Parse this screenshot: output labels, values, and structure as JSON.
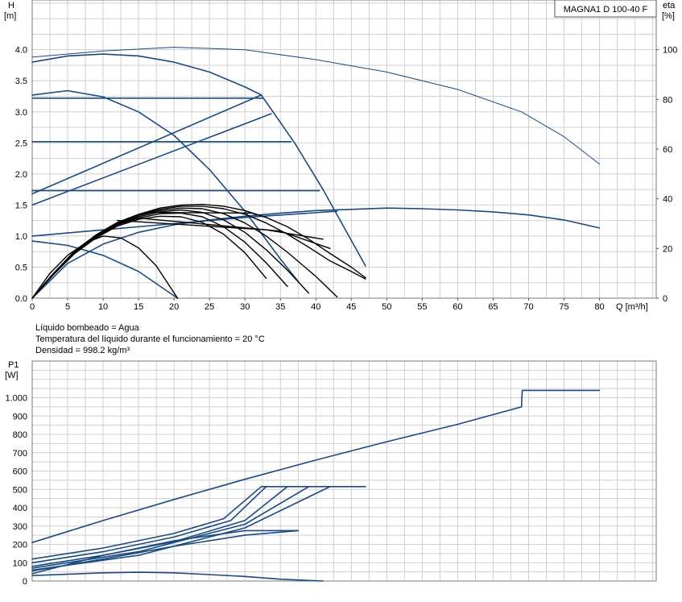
{
  "model_label": "MAGNA1 D 100-40 F",
  "info_lines": [
    "Líquido bombeado = Agua",
    "Temperatura del líquido durante el funcionamiento = 20 °C",
    "Densidad = 998.2 kg/m³"
  ],
  "chart_data": [
    {
      "type": "line",
      "title": "",
      "x_label": "Q [m³/h]",
      "y_label_line1": "H",
      "y_label_line2": "[m]",
      "y2_label_line1": "eta",
      "y2_label_line2": "[%]",
      "xlim": [
        0,
        88
      ],
      "ylim": [
        0,
        4.8
      ],
      "y2lim": [
        0,
        120
      ],
      "x_ticks": [
        "0",
        "5",
        "10",
        "15",
        "20",
        "25",
        "30",
        "35",
        "40",
        "45",
        "50",
        "55",
        "60",
        "65",
        "70",
        "75",
        "80"
      ],
      "y_ticks": [
        "0.0",
        "0.5",
        "1.0",
        "1.5",
        "2.0",
        "2.5",
        "3.0",
        "3.5",
        "4.0"
      ],
      "y2_ticks": [
        "0",
        "20",
        "40",
        "60",
        "80",
        "100"
      ],
      "grid": true,
      "series": [
        {
          "group": "head",
          "color": "#1a4a80",
          "points": [
            [
              0,
              3.8
            ],
            [
              5,
              3.9
            ],
            [
              10,
              3.93
            ],
            [
              15,
              3.9
            ],
            [
              20,
              3.8
            ],
            [
              25,
              3.64
            ],
            [
              30,
              3.4
            ],
            [
              32.3,
              3.27
            ]
          ]
        },
        {
          "group": "head",
          "color": "#1a4a80",
          "points": [
            [
              32.3,
              3.27
            ],
            [
              37,
              2.5
            ],
            [
              41,
              1.75
            ],
            [
              47,
              0.52
            ]
          ]
        },
        {
          "group": "head",
          "color": "#1a4a80",
          "points": [
            [
              0,
              3.27
            ],
            [
              5,
              3.34
            ],
            [
              10,
              3.24
            ],
            [
              15,
              3.0
            ],
            [
              20,
              2.62
            ],
            [
              25,
              2.07
            ],
            [
              30,
              1.4
            ],
            [
              35,
              0.63
            ],
            [
              37.5,
              0.27
            ]
          ]
        },
        {
          "group": "head",
          "color": "#1a4a80",
          "points": [
            [
              0,
              3.22
            ],
            [
              32.5,
              3.22
            ]
          ]
        },
        {
          "group": "head",
          "color": "#1a4a80",
          "points": [
            [
              0,
              2.52
            ],
            [
              36.5,
              2.52
            ]
          ]
        },
        {
          "group": "head",
          "color": "#1a4a80",
          "points": [
            [
              0,
              1.73
            ],
            [
              40.5,
              1.73
            ]
          ]
        },
        {
          "group": "head",
          "color": "#1a4a80",
          "points": [
            [
              0,
              1.68
            ],
            [
              32.3,
              3.27
            ]
          ]
        },
        {
          "group": "head",
          "color": "#1a4a80",
          "points": [
            [
              0,
              1.5
            ],
            [
              33.7,
              2.97
            ]
          ]
        },
        {
          "group": "head",
          "color": "#1a4a80",
          "points": [
            [
              0,
              1.0
            ],
            [
              10,
              1.1
            ],
            [
              20,
              1.2
            ],
            [
              30,
              1.3
            ],
            [
              43,
              1.4
            ]
          ]
        },
        {
          "group": "head",
          "color": "#1a4a80",
          "points": [
            [
              0,
              0.92
            ],
            [
              5,
              0.85
            ],
            [
              10,
              0.69
            ],
            [
              15,
              0.43
            ],
            [
              20.5,
              0.0
            ]
          ]
        },
        {
          "group": "head",
          "color": "#1a4a80",
          "points": [
            [
              0,
              0.0
            ],
            [
              5,
              0.56
            ],
            [
              10,
              0.87
            ],
            [
              15,
              1.06
            ],
            [
              20,
              1.18
            ],
            [
              25,
              1.26
            ],
            [
              30,
              1.32
            ],
            [
              35,
              1.37
            ],
            [
              40,
              1.41
            ],
            [
              45,
              1.43
            ],
            [
              50,
              1.45
            ],
            [
              55,
              1.44
            ],
            [
              60,
              1.42
            ],
            [
              65,
              1.39
            ],
            [
              70,
              1.34
            ],
            [
              75,
              1.26
            ],
            [
              80,
              1.13
            ]
          ]
        },
        {
          "group": "head",
          "color": "#000000",
          "points": [
            [
              0,
              0.0
            ],
            [
              3,
              0.38
            ],
            [
              6,
              0.72
            ],
            [
              9,
              0.97
            ],
            [
              12,
              1.16
            ],
            [
              15,
              1.27
            ],
            [
              18,
              1.32
            ],
            [
              21,
              1.31
            ],
            [
              24,
              1.22
            ],
            [
              27,
              1.03
            ],
            [
              30,
              0.73
            ],
            [
              33,
              0.32
            ]
          ]
        },
        {
          "group": "head",
          "color": "#000000",
          "points": [
            [
              0,
              0.0
            ],
            [
              3,
              0.38
            ],
            [
              6,
              0.73
            ],
            [
              9,
              0.98
            ],
            [
              12,
              1.18
            ],
            [
              15,
              1.29
            ],
            [
              18,
              1.36
            ],
            [
              21,
              1.37
            ],
            [
              24,
              1.31
            ],
            [
              27,
              1.15
            ],
            [
              30,
              0.9
            ],
            [
              33,
              0.57
            ],
            [
              36,
              0.19
            ]
          ]
        },
        {
          "group": "head",
          "color": "#000000",
          "points": [
            [
              0,
              0.0
            ],
            [
              3,
              0.39
            ],
            [
              6,
              0.74
            ],
            [
              9,
              0.99
            ],
            [
              12,
              1.19
            ],
            [
              15,
              1.31
            ],
            [
              18,
              1.39
            ],
            [
              21,
              1.42
            ],
            [
              24,
              1.38
            ],
            [
              27,
              1.26
            ],
            [
              30,
              1.06
            ],
            [
              33,
              0.78
            ],
            [
              36,
              0.45
            ],
            [
              39,
              0.08
            ]
          ]
        },
        {
          "group": "head",
          "color": "#000000",
          "points": [
            [
              0,
              0.0
            ],
            [
              3,
              0.39
            ],
            [
              6,
              0.74
            ],
            [
              9,
              1.0
            ],
            [
              12,
              1.2
            ],
            [
              15,
              1.33
            ],
            [
              18,
              1.41
            ],
            [
              21,
              1.45
            ],
            [
              24,
              1.44
            ],
            [
              27,
              1.36
            ],
            [
              30,
              1.21
            ],
            [
              33,
              1.0
            ],
            [
              36,
              0.74
            ],
            [
              40,
              0.35
            ],
            [
              43,
              0.02
            ]
          ]
        },
        {
          "group": "head",
          "color": "#000000",
          "points": [
            [
              0,
              0.0
            ],
            [
              3,
              0.4
            ],
            [
              6,
              0.75
            ],
            [
              9,
              1.01
            ],
            [
              12,
              1.21
            ],
            [
              15,
              1.34
            ],
            [
              18,
              1.43
            ],
            [
              21,
              1.48
            ],
            [
              24,
              1.48
            ],
            [
              27,
              1.44
            ],
            [
              30,
              1.35
            ],
            [
              33,
              1.21
            ],
            [
              36,
              1.03
            ],
            [
              39,
              0.82
            ],
            [
              42,
              0.6
            ],
            [
              45,
              0.43
            ],
            [
              47,
              0.31
            ]
          ]
        },
        {
          "group": "head",
          "color": "#000000",
          "points": [
            [
              0,
              0.0
            ],
            [
              3,
              0.4
            ],
            [
              6,
              0.76
            ],
            [
              9,
              1.02
            ],
            [
              12,
              1.22
            ],
            [
              15,
              1.35
            ],
            [
              18,
              1.45
            ],
            [
              21,
              1.5
            ],
            [
              24,
              1.51
            ],
            [
              27,
              1.48
            ],
            [
              30,
              1.41
            ],
            [
              33,
              1.3
            ],
            [
              36,
              1.15
            ],
            [
              39,
              0.95
            ],
            [
              42,
              0.72
            ],
            [
              45,
              0.5
            ],
            [
              47,
              0.33
            ]
          ]
        },
        {
          "group": "head",
          "color": "#000000",
          "points": [
            [
              0,
              0.0
            ],
            [
              2.5,
              0.4
            ],
            [
              5,
              0.69
            ],
            [
              7.5,
              0.89
            ],
            [
              10,
              1.0
            ],
            [
              12.5,
              0.97
            ],
            [
              15,
              0.81
            ],
            [
              17.5,
              0.52
            ],
            [
              20.5,
              0.0
            ]
          ]
        },
        {
          "group": "head",
          "color": "#000000",
          "points": [
            [
              12,
              1.25
            ],
            [
              33,
              1.1
            ],
            [
              41,
              0.95
            ]
          ]
        },
        {
          "group": "head",
          "color": "#000000",
          "points": [
            [
              14,
              1.3
            ],
            [
              35,
              1.08
            ],
            [
              42,
              0.8
            ]
          ]
        },
        {
          "group": "head",
          "color": "#000000",
          "points": [
            [
              16,
              1.38
            ],
            [
              31,
              1.37
            ],
            [
              33,
              1.3
            ]
          ]
        },
        {
          "group": "eta",
          "color": "#1a4a80",
          "points": [
            [
              0,
              97
            ],
            [
              10,
              99.5
            ],
            [
              20,
              101
            ],
            [
              30,
              100
            ],
            [
              40,
              96
            ],
            [
              50,
              91
            ],
            [
              60,
              84
            ],
            [
              69,
              75
            ],
            [
              75,
              65
            ],
            [
              80,
              54
            ]
          ]
        }
      ]
    },
    {
      "type": "line",
      "title": "",
      "y_label_line1": "P1",
      "y_label_line2": "[W]",
      "xlim": [
        0,
        88
      ],
      "ylim": [
        0,
        1200
      ],
      "y_ticks": [
        "0",
        "100",
        "200",
        "300",
        "400",
        "500",
        "600",
        "700",
        "800",
        "900",
        "1.000"
      ],
      "grid": true,
      "series": [
        {
          "color": "#1a4a80",
          "points": [
            [
              0,
              210
            ],
            [
              10,
              330
            ],
            [
              20,
              445
            ],
            [
              30,
              555
            ],
            [
              40,
              660
            ],
            [
              50,
              760
            ],
            [
              60,
              855
            ],
            [
              69,
              950
            ],
            [
              69.1,
              1040
            ],
            [
              80,
              1040
            ]
          ]
        },
        {
          "color": "#1a4a80",
          "points": [
            [
              0,
              120
            ],
            [
              10,
              180
            ],
            [
              20,
              260
            ],
            [
              27,
              340
            ],
            [
              32.3,
              515
            ],
            [
              47,
              515
            ]
          ]
        },
        {
          "color": "#1a4a80",
          "points": [
            [
              0,
              100
            ],
            [
              10,
              160
            ],
            [
              20,
              240
            ],
            [
              28,
              330
            ],
            [
              33,
              515
            ]
          ]
        },
        {
          "color": "#1a4a80",
          "points": [
            [
              0,
              80
            ],
            [
              10,
              140
            ],
            [
              20,
              215
            ],
            [
              30,
              330
            ],
            [
              36,
              515
            ]
          ]
        },
        {
          "color": "#1a4a80",
          "points": [
            [
              0,
              70
            ],
            [
              15,
              160
            ],
            [
              30,
              310
            ],
            [
              39,
              515
            ]
          ]
        },
        {
          "color": "#1a4a80",
          "points": [
            [
              0,
              60
            ],
            [
              15,
              140
            ],
            [
              30,
              290
            ],
            [
              42,
              515
            ]
          ]
        },
        {
          "color": "#1a4a80",
          "points": [
            [
              0,
              55
            ],
            [
              10,
              120
            ],
            [
              20,
              190
            ],
            [
              30,
              250
            ],
            [
              37.5,
              275
            ]
          ]
        },
        {
          "color": "#1a4a80",
          "points": [
            [
              0,
              40
            ],
            [
              10,
              140
            ],
            [
              20,
              220
            ],
            [
              30,
              275
            ],
            [
              37.5,
              275
            ]
          ]
        },
        {
          "color": "#1a4a80",
          "points": [
            [
              0,
              30
            ],
            [
              10,
              45
            ],
            [
              15,
              48
            ],
            [
              20,
              45
            ],
            [
              25,
              35
            ],
            [
              30,
              25
            ],
            [
              35,
              10
            ],
            [
              41,
              0
            ]
          ]
        }
      ]
    }
  ]
}
